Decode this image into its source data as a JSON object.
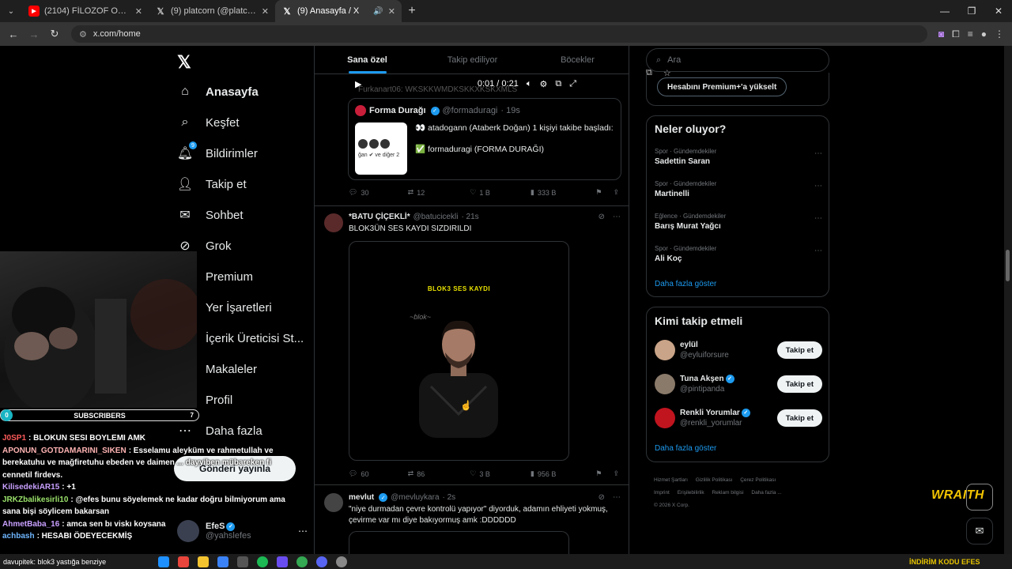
{
  "browser": {
    "tabs": [
      {
        "label": "(2104) FİLOZOF ORHAN EV ZİYARET",
        "favicon": "youtube-icon",
        "active": false
      },
      {
        "label": "(9) platcorn (@platcornweb) / X",
        "favicon": "x-icon",
        "active": false
      },
      {
        "label": "(9) Anasayfa / X",
        "favicon": "x-icon",
        "active": true
      }
    ],
    "url": "x.com/home"
  },
  "nav": {
    "logo": "X",
    "items": [
      {
        "label": "Anasayfa",
        "icon": "home-icon"
      },
      {
        "label": "Keşfet",
        "icon": "search-icon"
      },
      {
        "label": "Bildirimler",
        "icon": "bell-icon",
        "badge": "9"
      },
      {
        "label": "Takip et",
        "icon": "follow-icon"
      },
      {
        "label": "Sohbet",
        "icon": "mail-icon"
      },
      {
        "label": "Grok",
        "icon": "grok-icon"
      },
      {
        "label": "Premium",
        "icon": "x-icon"
      },
      {
        "label": "Yer İşaretleri",
        "icon": "bookmark-icon"
      },
      {
        "label": "İçerik Üreticisi St...",
        "icon": "creator-icon"
      },
      {
        "label": "Makaleler",
        "icon": "article-icon"
      },
      {
        "label": "Profil",
        "icon": "profile-icon"
      },
      {
        "label": "Daha fazla",
        "icon": "more-icon"
      }
    ],
    "post_button": "Gönderi yayınla",
    "account": {
      "name": "EfeS",
      "handle": "@yahslefes"
    }
  },
  "feed": {
    "tabs": [
      "Sana özel",
      "Takip ediliyor",
      "Böcekler"
    ],
    "player": {
      "time": "0:01 / 0:21",
      "overlay_text": "Furkanart06: WKSKKWMDKSKKXKSKXMLS"
    },
    "quote": {
      "name": "Forma Durağı",
      "handle": "@formaduragi",
      "time": "· 19s",
      "line1": "👀 atadogann (Ataberk Doğan) 1 kişiyi takibe başladı:",
      "line2": "✅ formaduragi (FORMA DURAĞI)",
      "img_text": "ğan ✔ ve diğer 2"
    },
    "post1_actions": {
      "replies": "30",
      "reposts": "12",
      "likes": "1 B",
      "views": "333 B"
    },
    "post2": {
      "name": "*BATU ÇİÇEKLİ*",
      "handle": "@batucicekli",
      "time": "· 21s",
      "text": "BLOK3ÜN SES KAYDI SIZDIRILDI",
      "media_title": "BLOK3 SES KAYDI",
      "actions": {
        "replies": "60",
        "reposts": "86",
        "likes": "3 B",
        "views": "956 B"
      }
    },
    "post3": {
      "name": "mevlut",
      "handle": "@mevluykara",
      "time": "· 2s",
      "text": "\"niye durmadan çevre kontrolü yapıyor\" diyorduk, adamın ehliyeti yokmuş, çevirme var mı diye bakıyormuş amk :DDDDDD"
    }
  },
  "sidebar": {
    "search_placeholder": "Ara",
    "premium_button": "Hesabını Premium+'a yükselt",
    "trends_title": "Neler oluyor?",
    "trends": [
      {
        "category": "Spor · Gündemdekiler",
        "name": "Sadettin Saran"
      },
      {
        "category": "Spor · Gündemdekiler",
        "name": "Martinelli"
      },
      {
        "category": "Eğlence · Gündemdekiler",
        "name": "Barış Murat Yağcı"
      },
      {
        "category": "Spor · Gündemdekiler",
        "name": "Ali Koç"
      }
    ],
    "show_more": "Daha fazla göster",
    "who_title": "Kimi takip etmeli",
    "who": [
      {
        "name": "eylül",
        "handle": "@eyluiforsure",
        "verified": false,
        "button": "Takip et"
      },
      {
        "name": "Tuna Akşen",
        "handle": "@pintipanda",
        "verified": true,
        "button": "Takip et"
      },
      {
        "name": "Renkli Yorumlar",
        "handle": "@renkli_yorumlar",
        "verified": true,
        "button": "Takip et"
      }
    ],
    "who_show_more": "Daha fazla göster",
    "footer": [
      "Hizmet Şartları",
      "Gizlilik Politikası",
      "Çerez Politikası",
      "Imprint",
      "Erişilebilirlik",
      "Reklam bilgisi",
      "Daha fazla ...",
      "© 2026 X Corp."
    ]
  },
  "overlay": {
    "subscribers_label": "SUBSCRIBERS",
    "subscribers_left": "0",
    "subscribers_right": "7",
    "chat": [
      {
        "user": "J0SP1",
        "color": "#ff5a5a",
        "msg": ": BLOKUN SESI BOYLEMI AMK"
      },
      {
        "user": "APONUN_GOTDAMARINI_SIKEN",
        "color": "#ffb3b3",
        "msg": ": Esselamu aleyküm ve rahmetullah ve berekatuhu ve mağfiretuhu ebeden ve daimen ... dayyiben mübareken fi cennetil firdevs."
      },
      {
        "user": "KilisedekiAR15",
        "color": "#c9a0ff",
        "msg": ": +1"
      },
      {
        "user": "JRKZbalikesirli10",
        "color": "#9be36b",
        "msg": ": @efes bunu söyelemek ne kadar doğru bilmiyorum ama sana bişi söylicem bakarsan"
      },
      {
        "user": "AhmetBaba_16",
        "color": "#c9a0ff",
        "msg": ": amca sen bı viskı koysana"
      },
      {
        "user": "achbash",
        "color": "#6fb6ff",
        "msg": ": HESABI ÖDEYECEKMİŞ"
      }
    ],
    "ticker": "davupitek: blok3 yastığa benziye",
    "brand": "WRAITH",
    "tray_text": "İNDİRİM KODU EFES"
  }
}
